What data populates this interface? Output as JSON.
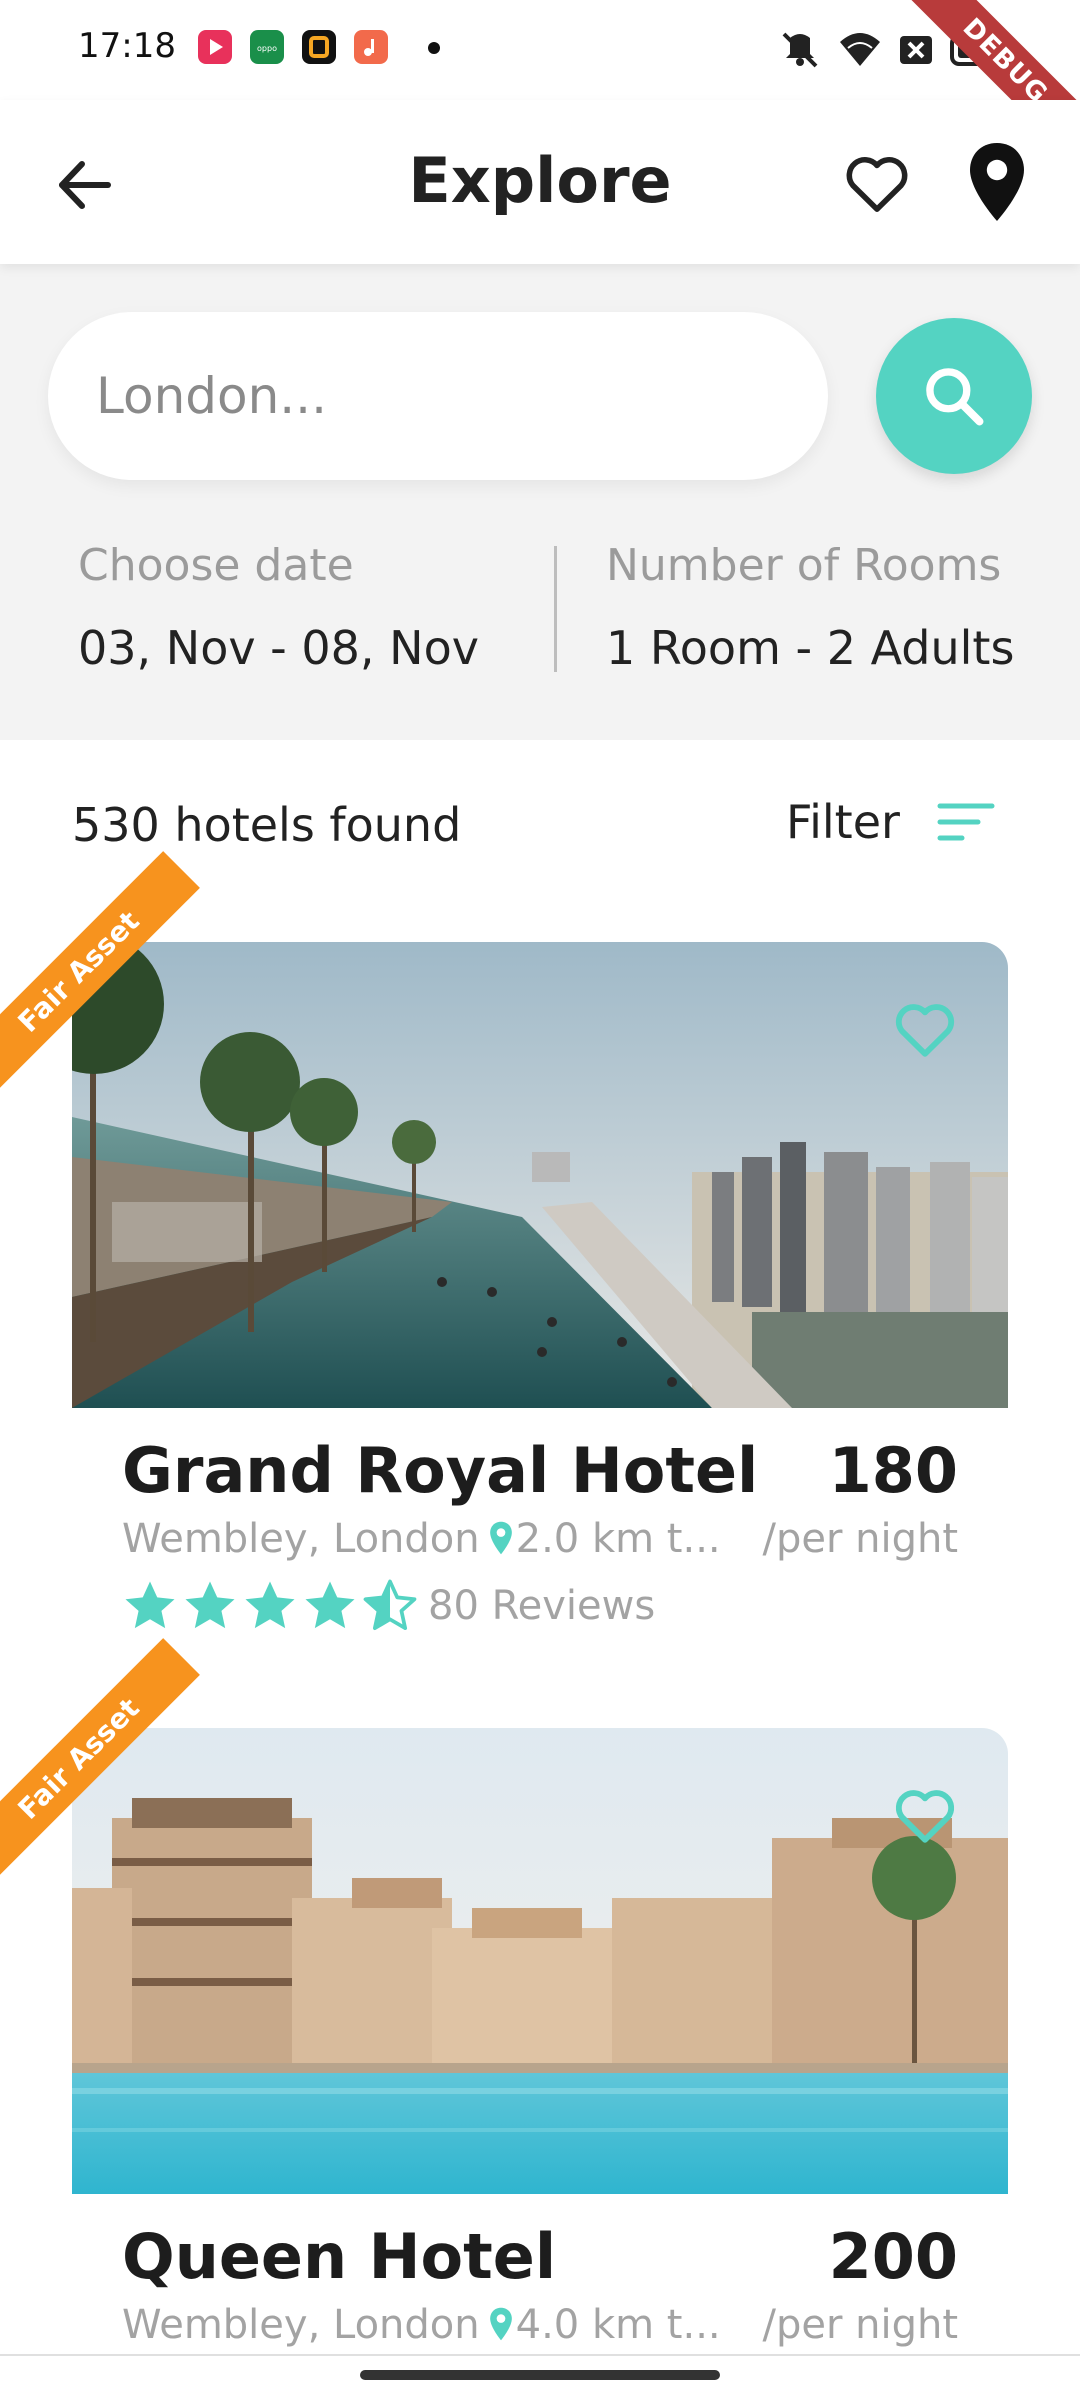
{
  "status_bar": {
    "time": "17:18",
    "debug_label": "DEBUG",
    "app_icons": [
      {
        "name": "video-app-icon",
        "color": "#e8315b"
      },
      {
        "name": "oppo-app-icon",
        "color": "#1a8f4a"
      },
      {
        "name": "orange-app-icon",
        "color": "#111111"
      },
      {
        "name": "music-app-icon",
        "color": "#f26a4b"
      }
    ]
  },
  "app_bar": {
    "title": "Explore",
    "back_icon": "arrow-left-icon",
    "favorite_icon": "heart-outline-icon",
    "location_icon": "map-pin-icon"
  },
  "search": {
    "placeholder": "London...",
    "button_icon": "search-icon"
  },
  "date": {
    "label": "Choose date",
    "value": "03, Nov - 08, Nov"
  },
  "rooms": {
    "label": "Number of Rooms",
    "value": "1 Room - 2 Adults"
  },
  "results": {
    "count_text": "530 hotels found",
    "filter_label": "Filter"
  },
  "hotels": [
    {
      "ribbon": "Fair Asset",
      "name": "Grand Royal Hotel",
      "price": "180",
      "location": "Wembley, London",
      "distance": "2.0 km t...",
      "per_night": "/per night",
      "rating": 4.5,
      "reviews": "80 Reviews"
    },
    {
      "ribbon": "Fair Asset",
      "name": "Queen Hotel",
      "price": "200",
      "location": "Wembley, London",
      "distance": "4.0 km t...",
      "per_night": "/per night"
    }
  ],
  "colors": {
    "accent": "#54d3c2",
    "ribbon": "#f7931e",
    "debug": "#b83b3b"
  }
}
